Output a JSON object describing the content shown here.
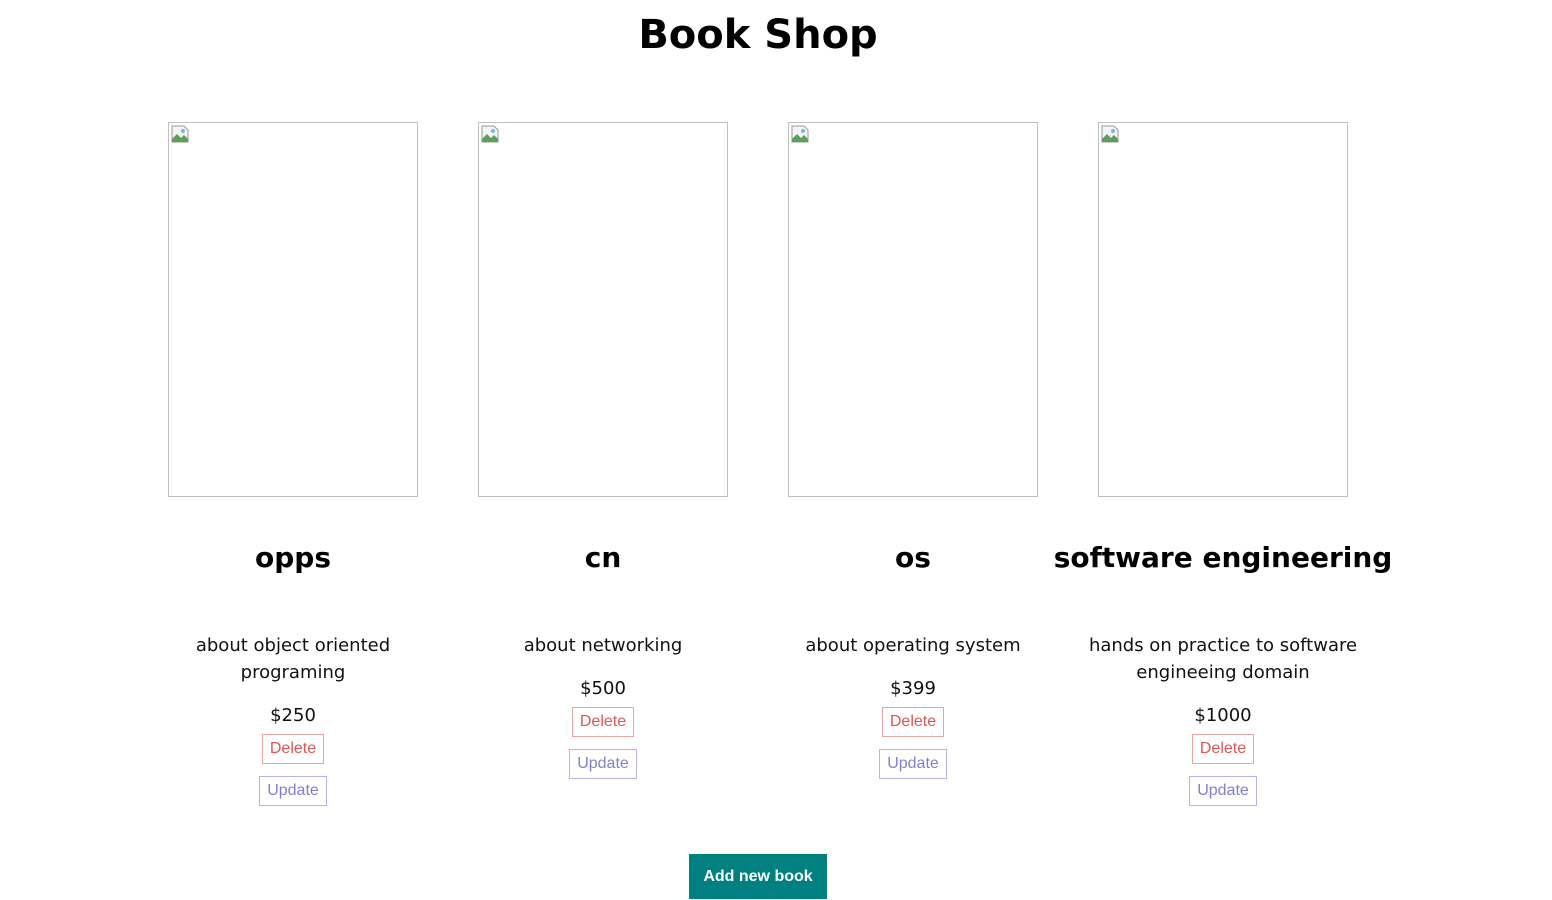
{
  "page": {
    "title": "Book Shop"
  },
  "books": [
    {
      "title": "opps",
      "description": "about object oriented programing",
      "price": "$250",
      "delete_label": "Delete",
      "update_label": "Update"
    },
    {
      "title": "cn",
      "description": "about networking",
      "price": "$500",
      "delete_label": "Delete",
      "update_label": "Update"
    },
    {
      "title": "os",
      "description": "about operating system",
      "price": "$399",
      "delete_label": "Delete",
      "update_label": "Update"
    },
    {
      "title": "software engineering",
      "description": "hands on practice to software engineeing domain",
      "price": "$1000",
      "delete_label": "Delete",
      "update_label": "Update"
    }
  ],
  "actions": {
    "add_label": "Add new book"
  },
  "colors": {
    "add_button_bg": "#008080",
    "delete_text": "#e05555",
    "update_text": "#8080d0"
  },
  "icons": {
    "cover": "broken-image-icon"
  }
}
